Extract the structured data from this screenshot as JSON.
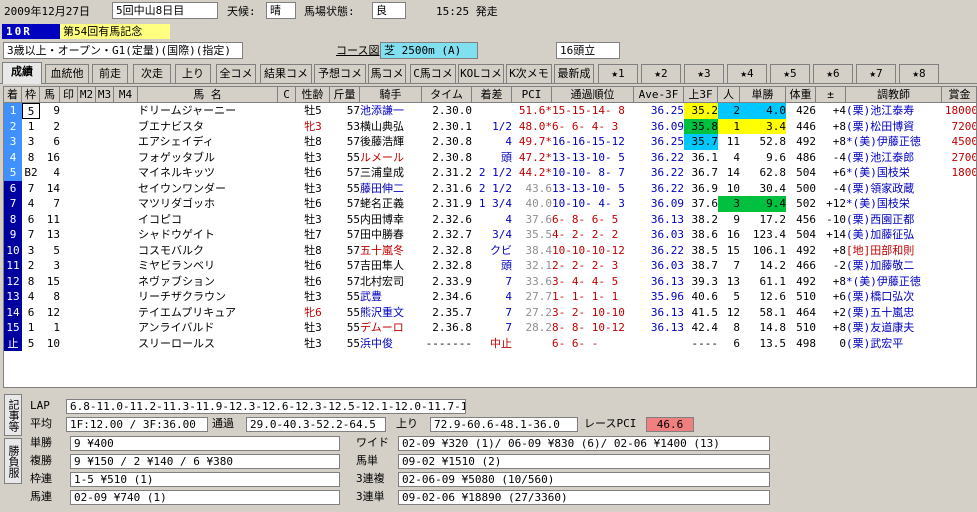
{
  "header": {
    "date": "2009年12月27日",
    "meeting": "5回中山8日目",
    "weather_label": "天候:",
    "weather": "晴",
    "track_label": "馬場状態:",
    "track": "良",
    "post_time": "15:25 発走",
    "race_number": "10R",
    "race_name": "第54回有馬記念",
    "conditions": "3歳以上・オープン・G1(定量)(国際)(指定)",
    "course_link": "コース図",
    "course": "芝 2500m (A)",
    "runners": "16頭立"
  },
  "tabs": [
    "成績",
    "血統他",
    "前走",
    "次走",
    "上り",
    "全コメ",
    "結果コメ",
    "予想コメ",
    "馬コメ",
    "C馬コメ",
    "KOLコメ",
    "K次メモ",
    "最新成",
    "★1",
    "★2",
    "★3",
    "★4",
    "★5",
    "★6",
    "★7",
    "★8"
  ],
  "table": {
    "columns": [
      "着",
      "枠",
      "馬",
      "印",
      "M2",
      "M3",
      "M4",
      "馬 名",
      "C",
      "性齢",
      "斤量",
      "騎手",
      "タイム",
      "着差",
      "PCI",
      "通過順位",
      "Ave-3F",
      "上3F",
      "人",
      "単勝",
      "体重",
      "±",
      "調教師",
      "賞金"
    ],
    "rows": [
      {
        "pos": "1",
        "waku": "5",
        "num": "9",
        "name": "ドリームジャーニー",
        "sex": "牡5",
        "wt": "57",
        "jockey": "池添謙一",
        "time": "2.30.0",
        "margin": "",
        "pci": "51.6*",
        "pass": "15-15-14- 8",
        "ave": "36.25",
        "f3": "35.2",
        "pop": "2",
        "odds": "4.0",
        "body": "426",
        "diff": "+4",
        "trainer": "(栗)池江泰寿",
        "prize": "18000"
      },
      {
        "pos": "2",
        "waku": "1",
        "num": "2",
        "name": "ブエナビスタ",
        "sex": "牝3",
        "wt": "53",
        "jockey": "横山典弘",
        "time": "2.30.1",
        "margin": "1/2",
        "pci": "48.0*",
        "pass": "6- 6- 4- 3",
        "ave": "36.09",
        "f3": "35.8",
        "pop": "1",
        "odds": "3.4",
        "body": "446",
        "diff": "+8",
        "trainer": "(栗)松田博資",
        "prize": "7200"
      },
      {
        "pos": "3",
        "waku": "3",
        "num": "6",
        "name": "エアシェイディ",
        "sex": "牡8",
        "wt": "57",
        "jockey": "後藤浩輝",
        "time": "2.30.8",
        "margin": "4",
        "pci": "49.7*",
        "pass": "16-16-15-12",
        "ave": "36.25",
        "f3": "35.7",
        "pop": "11",
        "odds": "52.8",
        "body": "492",
        "diff": "+8",
        "trainer": "*(美)伊藤正徳",
        "prize": "4500"
      },
      {
        "pos": "4",
        "waku": "8",
        "num": "16",
        "name": "フォゲッタブル",
        "sex": "牡3",
        "wt": "55",
        "jockey": "ルメール",
        "time": "2.30.8",
        "margin": "頭",
        "pci": "47.2*",
        "pass": "13-13-10- 5",
        "ave": "36.22",
        "f3": "36.1",
        "pop": "4",
        "odds": "9.6",
        "body": "486",
        "diff": "-4",
        "trainer": "(栗)池江泰郎",
        "prize": "2700"
      },
      {
        "pos": "5",
        "waku": "B2",
        "num": "4",
        "name": "マイネルキッツ",
        "sex": "牡6",
        "wt": "57",
        "jockey": "三浦皇成",
        "time": "2.31.2",
        "margin": "2 1/2",
        "pci": "44.2*",
        "pass": "10-10- 8- 7",
        "ave": "36.22",
        "f3": "36.7",
        "pop": "14",
        "odds": "62.8",
        "body": "504",
        "diff": "+6",
        "trainer": "*(美)国枝栄",
        "prize": "1800"
      },
      {
        "pos": "6",
        "waku": "7",
        "num": "14",
        "name": "セイウンワンダー",
        "sex": "牡3",
        "wt": "55",
        "jockey": "藤田伸二",
        "time": "2.31.6",
        "margin": "2 1/2",
        "pci": "43.6",
        "pass": "13-13-10- 5",
        "ave": "36.22",
        "f3": "36.9",
        "pop": "10",
        "odds": "30.4",
        "body": "500",
        "diff": "-4",
        "trainer": "(栗)領家政蔵",
        "prize": ""
      },
      {
        "pos": "7",
        "waku": "4",
        "num": "7",
        "name": "マツリダゴッホ",
        "sex": "牡6",
        "wt": "57",
        "jockey": "蛯名正義",
        "time": "2.31.9",
        "margin": "1 3/4",
        "pci": "40.0",
        "pass": "10-10- 4- 3",
        "ave": "36.09",
        "f3": "37.6",
        "pop": "3",
        "odds": "9.4",
        "body": "502",
        "diff": "+12",
        "trainer": "*(美)国枝栄",
        "prize": ""
      },
      {
        "pos": "8",
        "waku": "6",
        "num": "11",
        "name": "イコピコ",
        "sex": "牡3",
        "wt": "55",
        "jockey": "内田博幸",
        "time": "2.32.6",
        "margin": "4",
        "pci": "37.6",
        "pass": "6- 8- 6- 5",
        "ave": "36.13",
        "f3": "38.2",
        "pop": "9",
        "odds": "17.2",
        "body": "456",
        "diff": "-10",
        "trainer": "(栗)西園正都",
        "prize": ""
      },
      {
        "pos": "9",
        "waku": "7",
        "num": "13",
        "name": "シャドウゲイト",
        "sex": "牡7",
        "wt": "57",
        "jockey": "田中勝春",
        "time": "2.32.7",
        "margin": "3/4",
        "pci": "35.5",
        "pass": "4- 2- 2- 2",
        "ave": "36.03",
        "f3": "38.6",
        "pop": "16",
        "odds": "123.4",
        "body": "504",
        "diff": "+14",
        "trainer": "(美)加藤征弘",
        "prize": ""
      },
      {
        "pos": "10",
        "waku": "3",
        "num": "5",
        "name": "コスモバルク",
        "sex": "牡8",
        "wt": "57",
        "jockey": "五十嵐冬",
        "time": "2.32.8",
        "margin": "クビ",
        "pci": "38.4",
        "pass": "10-10-10-12",
        "ave": "36.22",
        "f3": "38.5",
        "pop": "15",
        "odds": "106.1",
        "body": "492",
        "diff": "+8",
        "trainer": "[地]田部和則",
        "prize": ""
      },
      {
        "pos": "11",
        "waku": "2",
        "num": "3",
        "name": "ミヤビランベリ",
        "sex": "牡6",
        "wt": "57",
        "jockey": "吉田隼人",
        "time": "2.32.8",
        "margin": "頭",
        "pci": "32.1",
        "pass": "2- 2- 2- 3",
        "ave": "36.03",
        "f3": "38.7",
        "pop": "7",
        "odds": "14.2",
        "body": "466",
        "diff": "-2",
        "trainer": "(栗)加藤敬二",
        "prize": ""
      },
      {
        "pos": "12",
        "waku": "8",
        "num": "15",
        "name": "ネヴァブション",
        "sex": "牡6",
        "wt": "57",
        "jockey": "北村宏司",
        "time": "2.33.9",
        "margin": "7",
        "pci": "33.6",
        "pass": "3- 4- 4- 5",
        "ave": "36.13",
        "f3": "39.3",
        "pop": "13",
        "odds": "61.1",
        "body": "492",
        "diff": "+8",
        "trainer": "*(美)伊藤正徳",
        "prize": ""
      },
      {
        "pos": "13",
        "waku": "4",
        "num": "8",
        "name": "リーチザクラウン",
        "sex": "牡3",
        "wt": "55",
        "jockey": "武豊",
        "time": "2.34.6",
        "margin": "4",
        "pci": "27.7",
        "pass": "1- 1- 1- 1",
        "ave": "35.96",
        "f3": "40.6",
        "pop": "5",
        "odds": "12.6",
        "body": "510",
        "diff": "+6",
        "trainer": "(栗)橋口弘次",
        "prize": ""
      },
      {
        "pos": "14",
        "waku": "6",
        "num": "12",
        "name": "テイエムプリキュア",
        "sex": "牝6",
        "wt": "55",
        "jockey": "熊沢重文",
        "time": "2.35.7",
        "margin": "7",
        "pci": "27.2",
        "pass": "3- 2- 10-10",
        "ave": "36.13",
        "f3": "41.5",
        "pop": "12",
        "odds": "58.1",
        "body": "464",
        "diff": "+2",
        "trainer": "(栗)五十嵐忠",
        "prize": ""
      },
      {
        "pos": "15",
        "waku": "1",
        "num": "1",
        "name": "アンライバルド",
        "sex": "牡3",
        "wt": "55",
        "jockey": "デムーロ",
        "time": "2.36.8",
        "margin": "7",
        "pci": "28.2",
        "pass": "8- 8- 10-12",
        "ave": "36.13",
        "f3": "42.4",
        "pop": "8",
        "odds": "14.8",
        "body": "510",
        "diff": "+8",
        "trainer": "(栗)友道康夫",
        "prize": ""
      },
      {
        "pos": "止",
        "waku": "5",
        "num": "10",
        "name": "スリーロールス",
        "sex": "牡3",
        "wt": "55",
        "jockey": "浜中俊",
        "time": "-------",
        "margin": "中止",
        "pci": "",
        "pass": "6- 6- -",
        "ave": "",
        "f3": "----",
        "pop": "6",
        "odds": "13.5",
        "body": "498",
        "diff": "0",
        "trainer": "(栗)武宏平",
        "prize": ""
      }
    ]
  },
  "bottom": {
    "vtab1": "記事等",
    "vtab2": "勝負服",
    "lap_label": "LAP",
    "lap": "6.8-11.0-11.2-11.3-11.9-12.3-12.6-12.3-12.5-12.1-12.0-11.7-12.3",
    "avg_label": "平均",
    "avg": "1F:12.00 / 3F:36.00",
    "pass_label": "通過",
    "pass": "29.0-40.3-52.2-64.5",
    "agari_label": "上り",
    "agari": "72.9-60.6-48.1-36.0",
    "pci_label": "レースPCI",
    "pci": "46.6",
    "win_label": "単勝",
    "win": "9 ¥400",
    "place_label": "複勝",
    "place": "9 ¥150 / 2 ¥140 / 6 ¥380",
    "waku_label": "枠連",
    "waku": "1-5 ¥510 (1)",
    "umaren_label": "馬連",
    "umaren": "02-09 ¥740 (1)",
    "wide_label": "ワイド",
    "wide": "02-09 ¥320 (1)/ 06-09 ¥830 (6)/ 02-06 ¥1400 (13)",
    "umatan_label": "馬単",
    "umatan": "09-02 ¥1510 (2)",
    "trio_label": "3連複",
    "trio": "02-06-09 ¥5080 (10/560)",
    "trifecta_label": "3連単",
    "trifecta": "09-02-06 ¥18890 (27/3360)"
  }
}
